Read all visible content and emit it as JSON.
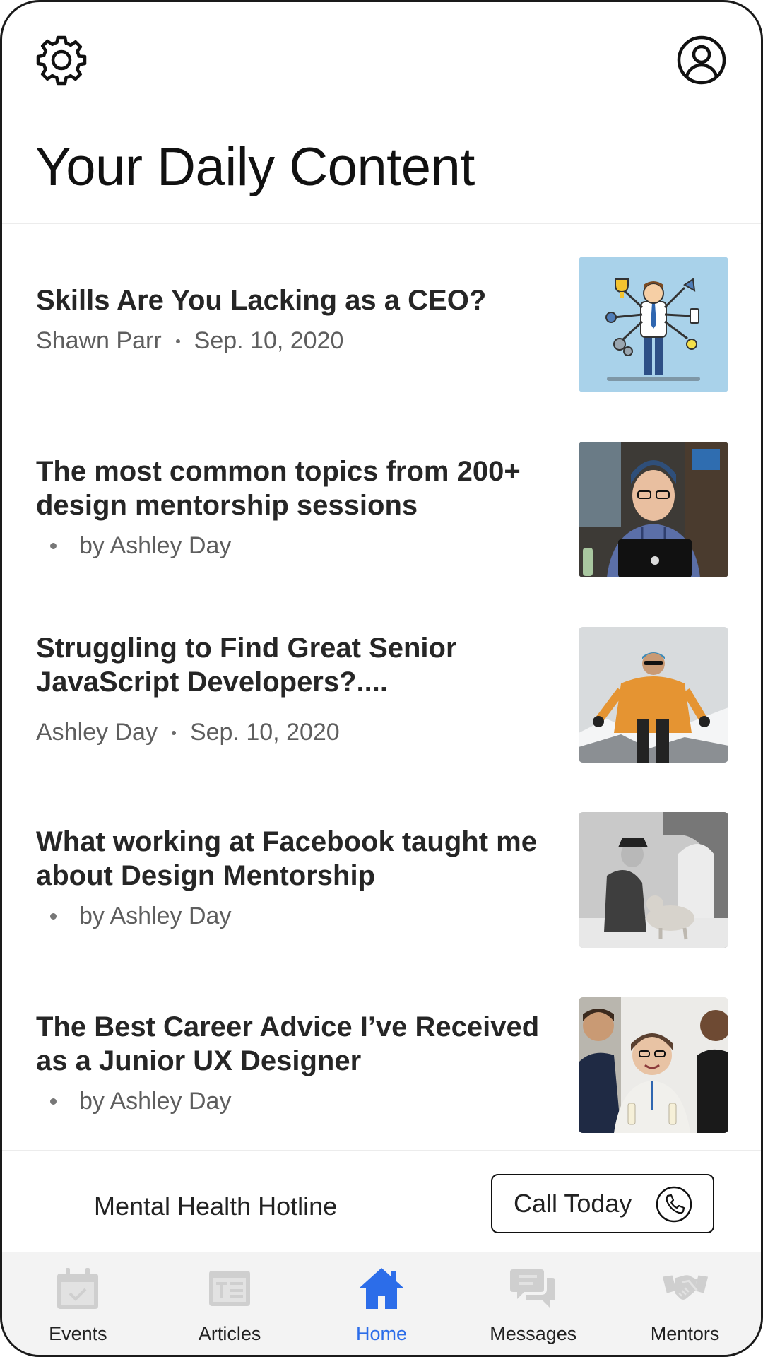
{
  "header": {
    "settings_icon": "gear-icon",
    "profile_icon": "user-circle-icon",
    "title": "Your Daily Content"
  },
  "articles": [
    {
      "title": "Skills Are You Lacking as a CEO?",
      "author": "Shawn Parr",
      "date": "Sep. 10, 2020",
      "style": "author-date",
      "thumbnail": "ceo-multitasking-illustration"
    },
    {
      "title": "The most common topics from 200+ design mentorship sessions",
      "byline": "by Ashley Day",
      "style": "byline",
      "thumbnail": "man-with-headphones-laptop-photo"
    },
    {
      "title": "Struggling to Find Great Senior JavaScript Developers?....",
      "author": "Ashley Day",
      "date": "Sep. 10, 2020",
      "style": "author-date",
      "thumbnail": "mountain-climber-photo"
    },
    {
      "title": "What working at Facebook taught me about Design Mentorship",
      "byline": "by Ashley Day",
      "style": "byline",
      "thumbnail": "man-with-dog-vintage-photo"
    },
    {
      "title": "The Best Career Advice I’ve Received as a Junior UX Designer",
      "byline": "by Ashley Day",
      "style": "byline",
      "thumbnail": "people-networking-event-photo"
    }
  ],
  "hotline": {
    "label": "Mental Health Hotline",
    "button_label": "Call Today",
    "button_icon": "phone-icon"
  },
  "tabs": [
    {
      "label": "Events",
      "icon": "calendar-check-icon",
      "active": false
    },
    {
      "label": "Articles",
      "icon": "article-icon",
      "active": false
    },
    {
      "label": "Home",
      "icon": "home-icon",
      "active": true
    },
    {
      "label": "Messages",
      "icon": "chat-bubbles-icon",
      "active": false
    },
    {
      "label": "Mentors",
      "icon": "handshake-icon",
      "active": false
    }
  ],
  "colors": {
    "accent": "#2c6de9",
    "inactive_icon": "#cfcfcf",
    "tabbar_bg": "#f3f3f3",
    "title_text": "#262626",
    "meta_text": "#5e5e5e"
  }
}
